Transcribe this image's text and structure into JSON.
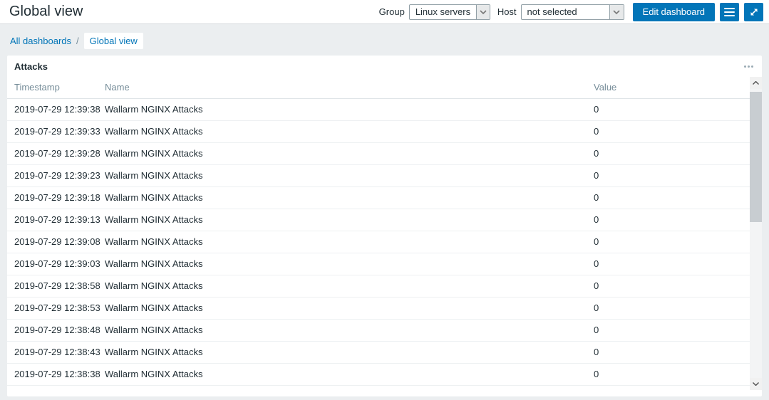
{
  "header": {
    "title": "Global view",
    "group": {
      "label": "Group",
      "value": "Linux servers"
    },
    "host": {
      "label": "Host",
      "value": "not selected"
    },
    "edit_button_label": "Edit dashboard"
  },
  "breadcrumb": {
    "items": [
      {
        "label": "All dashboards"
      },
      {
        "label": "Global view"
      }
    ],
    "separator": "/"
  },
  "widget": {
    "title": "Attacks",
    "menu_icon": "ellipsis-icon",
    "table": {
      "columns": [
        "Timestamp",
        "Name",
        "Value"
      ],
      "rows": [
        {
          "timestamp": "2019-07-29 12:39:38",
          "name": "Wallarm NGINX Attacks",
          "value": "0"
        },
        {
          "timestamp": "2019-07-29 12:39:33",
          "name": "Wallarm NGINX Attacks",
          "value": "0"
        },
        {
          "timestamp": "2019-07-29 12:39:28",
          "name": "Wallarm NGINX Attacks",
          "value": "0"
        },
        {
          "timestamp": "2019-07-29 12:39:23",
          "name": "Wallarm NGINX Attacks",
          "value": "0"
        },
        {
          "timestamp": "2019-07-29 12:39:18",
          "name": "Wallarm NGINX Attacks",
          "value": "0"
        },
        {
          "timestamp": "2019-07-29 12:39:13",
          "name": "Wallarm NGINX Attacks",
          "value": "0"
        },
        {
          "timestamp": "2019-07-29 12:39:08",
          "name": "Wallarm NGINX Attacks",
          "value": "0"
        },
        {
          "timestamp": "2019-07-29 12:39:03",
          "name": "Wallarm NGINX Attacks",
          "value": "0"
        },
        {
          "timestamp": "2019-07-29 12:38:58",
          "name": "Wallarm NGINX Attacks",
          "value": "0"
        },
        {
          "timestamp": "2019-07-29 12:38:53",
          "name": "Wallarm NGINX Attacks",
          "value": "0"
        },
        {
          "timestamp": "2019-07-29 12:38:48",
          "name": "Wallarm NGINX Attacks",
          "value": "0"
        },
        {
          "timestamp": "2019-07-29 12:38:43",
          "name": "Wallarm NGINX Attacks",
          "value": "0"
        },
        {
          "timestamp": "2019-07-29 12:38:38",
          "name": "Wallarm NGINX Attacks",
          "value": "0"
        }
      ]
    }
  },
  "icons": {
    "group_select": "chevron-down-icon",
    "host_select": "chevron-down-icon",
    "menu_button": "hamburger-icon",
    "fullscreen_button": "expand-arrows-icon",
    "widget_menu": "ellipsis-icon",
    "scroll_up": "chevron-up-icon",
    "scroll_down": "chevron-down-icon"
  },
  "colors": {
    "accent": "#0275b8",
    "text": "#1f2c33",
    "muted": "#768d99",
    "page_bg": "#ebeef0"
  }
}
